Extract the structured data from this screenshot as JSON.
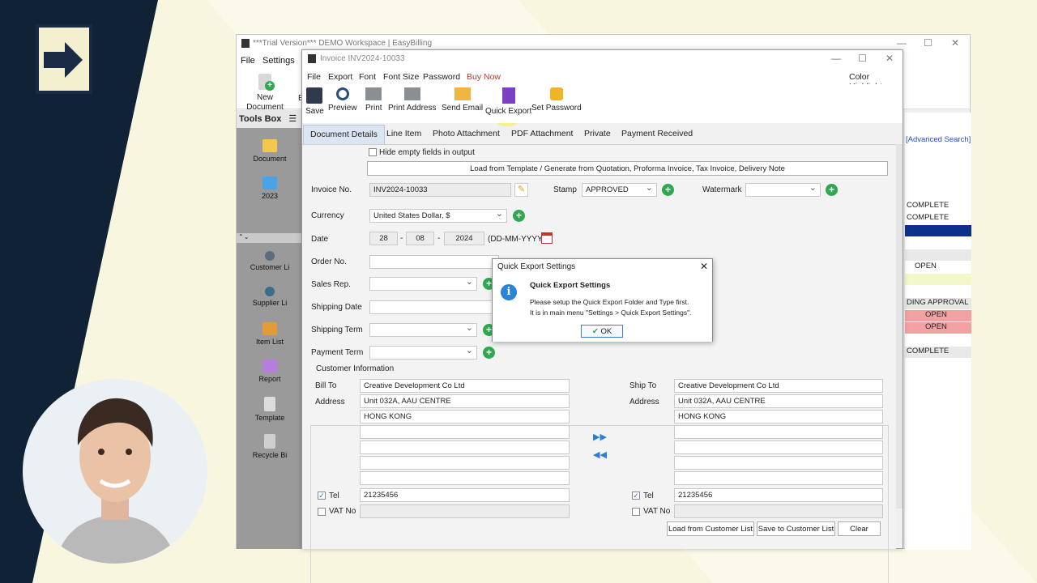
{
  "main_window": {
    "title": "***Trial Version*** DEMO Workspace | EasyBilling",
    "menu": [
      "File",
      "Settings"
    ],
    "toolbar": {
      "new_document": "New Document",
      "partial": "E"
    },
    "tools_box": "Tools Box",
    "sidebar": [
      {
        "label": "Document",
        "icon": "folder-icon"
      },
      {
        "label": "2023",
        "icon": "folder-icon"
      },
      {
        "label": "Customer Li",
        "icon": "customer-icon"
      },
      {
        "label": "Supplier Li",
        "icon": "supplier-icon"
      },
      {
        "label": "Item List",
        "icon": "item-list-icon"
      },
      {
        "label": "Report",
        "icon": "report-icon"
      },
      {
        "label": "Template",
        "icon": "template-icon"
      },
      {
        "label": "Recycle Bi",
        "icon": "recycle-bin-icon"
      }
    ],
    "advanced_search": "[Advanced Search]",
    "status_list": [
      {
        "text": "COMPLETE",
        "bg": "#ffffff"
      },
      {
        "text": "COMPLETE",
        "bg": "#ffffff"
      },
      {
        "text": "",
        "bg": "#0e2f8a"
      },
      {
        "text": "",
        "bg": "#ffffff"
      },
      {
        "text": "",
        "bg": "#e9e9e9"
      },
      {
        "text": "OPEN",
        "bg": "#ffffff"
      },
      {
        "text": "",
        "bg": "#f4f7c8"
      },
      {
        "text": "",
        "bg": "#ffffff"
      },
      {
        "text": "DING APPROVAL",
        "bg": "#e6e6e6"
      },
      {
        "text": "OPEN",
        "bg": "#f2a1a1"
      },
      {
        "text": "OPEN",
        "bg": "#f2a1a1"
      },
      {
        "text": "",
        "bg": "#ffffff"
      },
      {
        "text": "COMPLETE",
        "bg": "#e9e9e9"
      }
    ]
  },
  "invoice_window": {
    "title": "Invoice INV2024-10033",
    "menu": [
      "File",
      "Export",
      "Font",
      "Font Size",
      "Password",
      "Buy Now"
    ],
    "color_highlight": "Color Highlight",
    "toolbar": [
      "Save",
      "Preview",
      "Print",
      "Print Address",
      "Send Email",
      "Quick Export",
      "Set Password"
    ],
    "tabs": [
      "Document Details",
      "Line Item",
      "Photo Attachment",
      "PDF Attachment",
      "Private",
      "Payment Received"
    ],
    "hide_empty": "Hide empty fields in output",
    "load_template": "Load from Template / Generate from Quotation, Proforma Invoice, Tax Invoice, Delivery Note",
    "invoice_no_label": "Invoice No.",
    "invoice_no": "INV2024-10033",
    "stamp_label": "Stamp",
    "stamp": "APPROVED",
    "watermark_label": "Watermark",
    "watermark": "",
    "currency_label": "Currency",
    "currency": "United States Dollar, $",
    "date_label": "Date",
    "date_day": "28",
    "date_month": "08",
    "date_year": "2024",
    "date_sep": "-",
    "date_format": "(DD-MM-YYYY)",
    "order_no_label": "Order No.",
    "sales_rep_label": "Sales Rep.",
    "shipping_date_label": "Shipping Date",
    "shipping_term_label": "Shipping Term",
    "payment_term_label": "Payment Term",
    "customer_info": "Customer Information",
    "bill_to_label": "Bill To",
    "bill_to": "Creative Development Co Ltd",
    "address_label": "Address",
    "bill_address": [
      "Unit 032A, AAU CENTRE",
      "HONG KONG",
      "",
      "",
      "",
      ""
    ],
    "ship_to_label": "Ship To",
    "ship_to": "Creative Development Co Ltd",
    "ship_address": [
      "Unit 032A, AAU CENTRE",
      "HONG KONG",
      "",
      "",
      "",
      ""
    ],
    "tel_label": "Tel",
    "bill_tel": "21235456",
    "ship_tel": "21235456",
    "vat_label": "VAT No",
    "load_customer": "Load from Customer List",
    "save_customer": "Save to Customer List",
    "clear": "Clear"
  },
  "dialog": {
    "title": "Quick Export Settings",
    "heading": "Quick Export Settings",
    "line1": "Please setup the Quick Export Folder and Type first.",
    "line2": "It is in main menu \"Settings > Quick Export Settings\".",
    "ok": "OK"
  }
}
